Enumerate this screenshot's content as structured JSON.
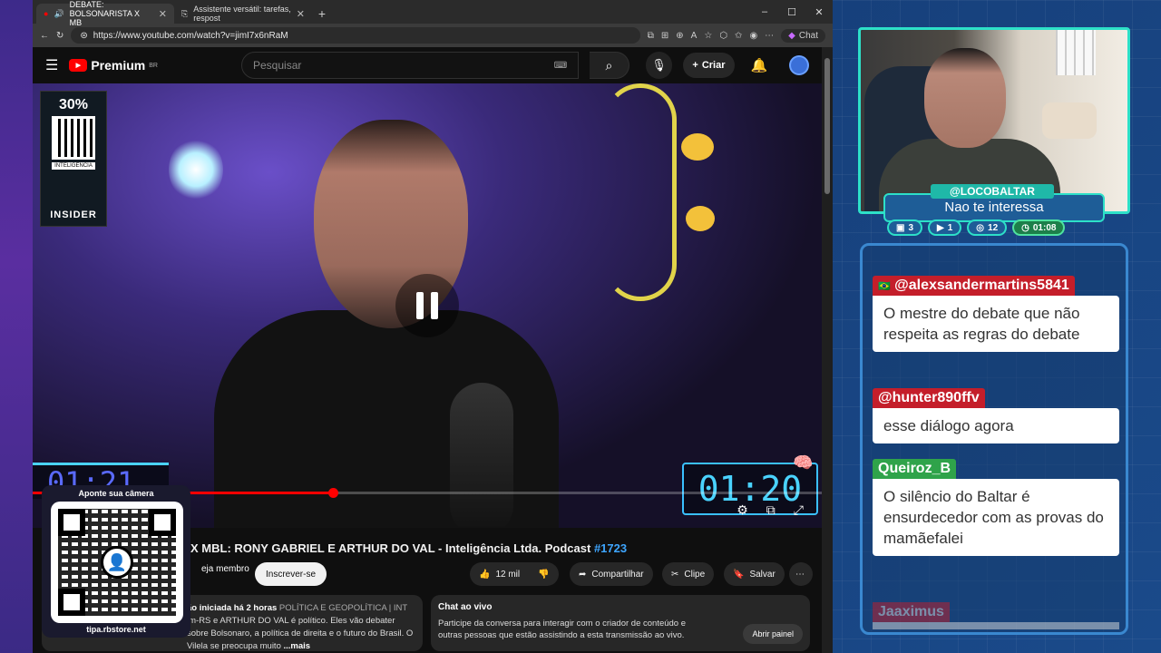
{
  "browser": {
    "tabs": [
      {
        "label": "DEBATE: BOLSONARISTA X MB",
        "active": true
      },
      {
        "label": "Assistente versátil: tarefas, respost",
        "active": false
      }
    ],
    "url": "https://www.youtube.com/watch?v=jimI7x6nRaM",
    "chat_label": "Chat"
  },
  "youtube": {
    "logo": "Premium",
    "region": "BR",
    "search_placeholder": "Pesquisar",
    "create_label": "Criar",
    "video_title_prefix": "X MBL: RONY GABRIEL E ARTHUR DO VAL - Inteligência Ltda. Podcast ",
    "video_tag": "#1723",
    "seja_membro": "eja membro",
    "subscribe": "Inscrever-se",
    "likes": "12 mil",
    "share": "Compartilhar",
    "clip": "Clipe",
    "save": "Salvar",
    "desc_meta": "ão iniciada há 2 horas",
    "desc_category": "POLÍTICA E GEOPOLÍTICA | INT",
    "desc_line2": "im-RS e ARTHUR DO VAL é político. Eles vão debater",
    "desc_line3": "sobre Bolsonaro, a política de direita e o futuro do Brasil. O Vilela se preocupa muito",
    "desc_more": "...mais",
    "live_chat_title": "Chat ao vivo",
    "live_chat_text": "Participe da conversa para interagir com o criador de conteúdo e outras pessoas que estão assistindo a esta transmissão ao vivo.",
    "live_chat_btn": "Abrir painel"
  },
  "video_overlay": {
    "insider_discount": "30%",
    "insider_label": "INTELIGENCIA",
    "insider_brand": "INSIDER",
    "clock_left": "01:21",
    "clock_right": "01:20",
    "progress": 0.38
  },
  "qr": {
    "caption": "Aponte sua câmera",
    "url": "tipa.rbstore.net"
  },
  "stream": {
    "handle": "@LOCOBALTAR",
    "message": "Nao te interessa",
    "stats": [
      {
        "icon": "chat-icon",
        "value": "3"
      },
      {
        "icon": "youtube-icon",
        "value": "1"
      },
      {
        "icon": "rumble-icon",
        "value": "12"
      },
      {
        "icon": "clock-icon",
        "value": "01:08"
      }
    ]
  },
  "chat": [
    {
      "user": "@alexsandermartins5841",
      "text": "O mestre do debate que não respeita as regras do debate",
      "color": "#c41e2a"
    },
    {
      "user": "@hunter890ffv",
      "text": "esse diálogo agora",
      "color": "#c41e2a"
    },
    {
      "user": "Queiroz_B",
      "text": "O silêncio do Baltar é ensurdecedor com as provas do mamãefalei",
      "color": "#2fa34a"
    },
    {
      "user": "Jaaximus",
      "text": "",
      "color": "#c41e2a"
    }
  ]
}
